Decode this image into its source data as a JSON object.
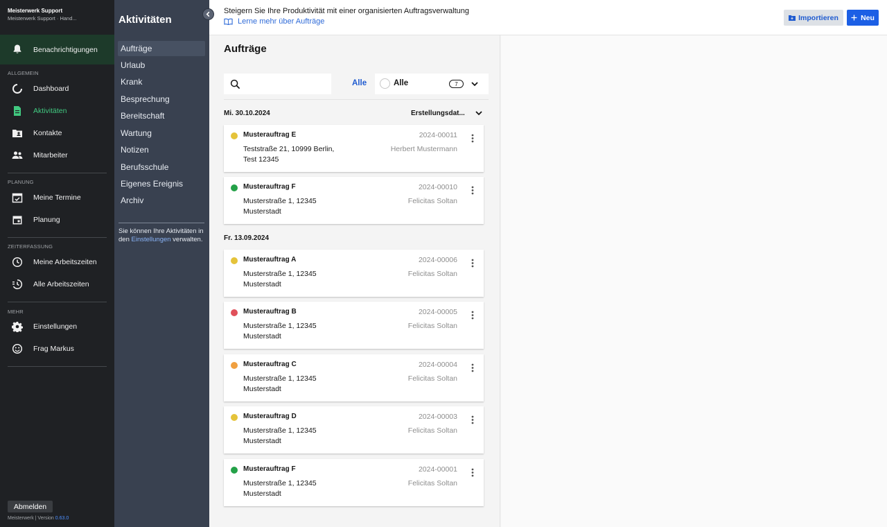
{
  "brand": {
    "title": "Meisterwerk Support",
    "subtitle": "Meisterwerk Support · Hand..."
  },
  "sidebar": {
    "notifications_label": "Benachrichtigungen",
    "sections": [
      {
        "title": "ALLGEMEIN",
        "items": [
          {
            "label": "Dashboard",
            "icon": "dashboard-icon"
          },
          {
            "label": "Aktivitäten",
            "icon": "document-icon",
            "active": true
          },
          {
            "label": "Kontakte",
            "icon": "contacts-folder-icon"
          },
          {
            "label": "Mitarbeiter",
            "icon": "people-icon"
          }
        ]
      },
      {
        "title": "PLANUNG",
        "items": [
          {
            "label": "Meine Termine",
            "icon": "calendar-check-icon"
          },
          {
            "label": "Planung",
            "icon": "calendar-icon"
          }
        ]
      },
      {
        "title": "ZEITERFASSUNG",
        "items": [
          {
            "label": "Meine Arbeitszeiten",
            "icon": "clock-icon"
          },
          {
            "label": "Alle Arbeitszeiten",
            "icon": "history-icon"
          }
        ]
      },
      {
        "title": "MEHR",
        "items": [
          {
            "label": "Einstellungen",
            "icon": "gear-icon"
          },
          {
            "label": "Frag Markus",
            "icon": "smiley-icon"
          }
        ]
      }
    ],
    "logout_label": "Abmelden",
    "version_prefix": "Meisterwerk | Version",
    "version_number": "0.63.0"
  },
  "types_panel": {
    "title": "Aktivitäten",
    "items": [
      "Aufträge",
      "Urlaub",
      "Krank",
      "Besprechung",
      "Bereitschaft",
      "Wartung",
      "Notizen",
      "Berufsschule",
      "Eigenes Ereignis",
      "Archiv"
    ],
    "note_before": "Sie können Ihre Aktivitäten in den ",
    "note_link": "Einstellungen",
    "note_after": " verwalten."
  },
  "banner": {
    "tagline": "Steigern Sie Ihre Produktivität mit einer organisierten Auftragsverwaltung",
    "learn_more": "Lerne mehr über Aufträge",
    "import_label": "Importieren",
    "new_label": "Neu"
  },
  "list": {
    "heading": "Aufträge",
    "search_placeholder": "",
    "filter_link": "Alle",
    "filter_label": "Alle",
    "filter_count": "7",
    "sort_label": "Erstellungsdat...",
    "groups": [
      {
        "date": "Mi. 30.10.2024",
        "cards": [
          {
            "name": "Musterauftrag E",
            "addr1": "Teststraße 21, 10999 Berlin,",
            "addr2": "Test 12345",
            "number": "2024-00011",
            "person": "Herbert Mustermann",
            "color": "#e5c33a"
          },
          {
            "name": "Musterauftrag F",
            "addr1": "Musterstraße 1, 12345",
            "addr2": "Musterstadt",
            "number": "2024-00010",
            "person": "Felicitas Soltan",
            "color": "#24a148"
          }
        ]
      },
      {
        "date": "Fr. 13.09.2024",
        "cards": [
          {
            "name": "Musterauftrag A",
            "addr1": "Musterstraße 1, 12345",
            "addr2": "Musterstadt",
            "number": "2024-00006",
            "person": "Felicitas Soltan",
            "color": "#e5c33a"
          },
          {
            "name": "Musterauftrag B",
            "addr1": "Musterstraße 1, 12345",
            "addr2": "Musterstadt",
            "number": "2024-00005",
            "person": "Felicitas Soltan",
            "color": "#e0505a"
          },
          {
            "name": "Musterauftrag C",
            "addr1": "Musterstraße 1, 12345",
            "addr2": "Musterstadt",
            "number": "2024-00004",
            "person": "Felicitas Soltan",
            "color": "#f0a040"
          },
          {
            "name": "Musterauftrag D",
            "addr1": "Musterstraße 1, 12345",
            "addr2": "Musterstadt",
            "number": "2024-00003",
            "person": "Felicitas Soltan",
            "color": "#e5c33a"
          },
          {
            "name": "Musterauftrag F",
            "addr1": "Musterstraße 1, 12345",
            "addr2": "Musterstadt",
            "number": "2024-00001",
            "person": "Felicitas Soltan",
            "color": "#24a148"
          }
        ]
      }
    ]
  },
  "colors": {
    "accent": "#1c5fe5",
    "sidebar_bg": "#1f2124",
    "panel_bg": "#394150",
    "active_green": "#41c980"
  }
}
